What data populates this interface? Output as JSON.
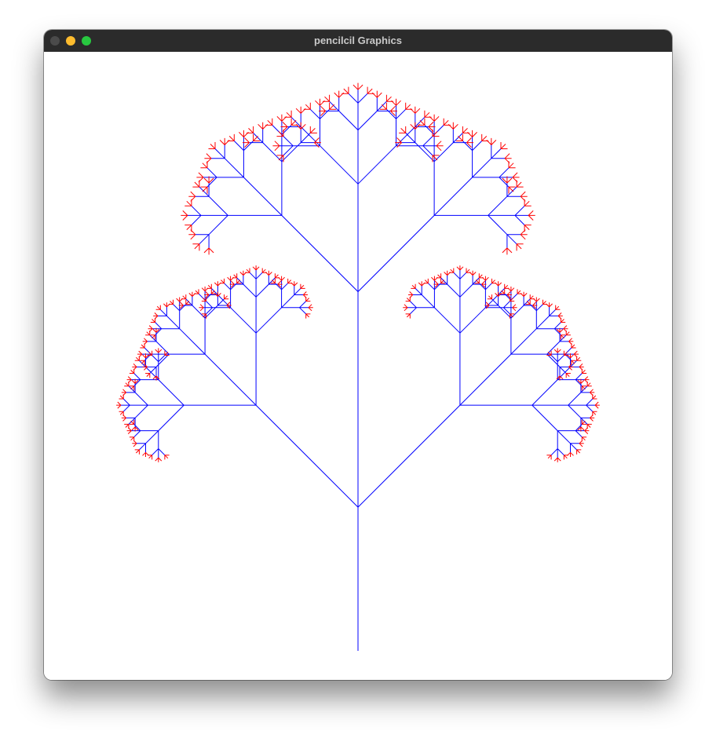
{
  "window": {
    "title": "pencilcil Graphics",
    "controls": {
      "close": "close-icon",
      "minimize": "minimize-icon",
      "maximize": "maximize-icon"
    }
  },
  "canvas": {
    "background": "#ffffff",
    "branch_color": "#0000ff",
    "tip_color": "#ff0000",
    "figure": "fractal-tree"
  }
}
